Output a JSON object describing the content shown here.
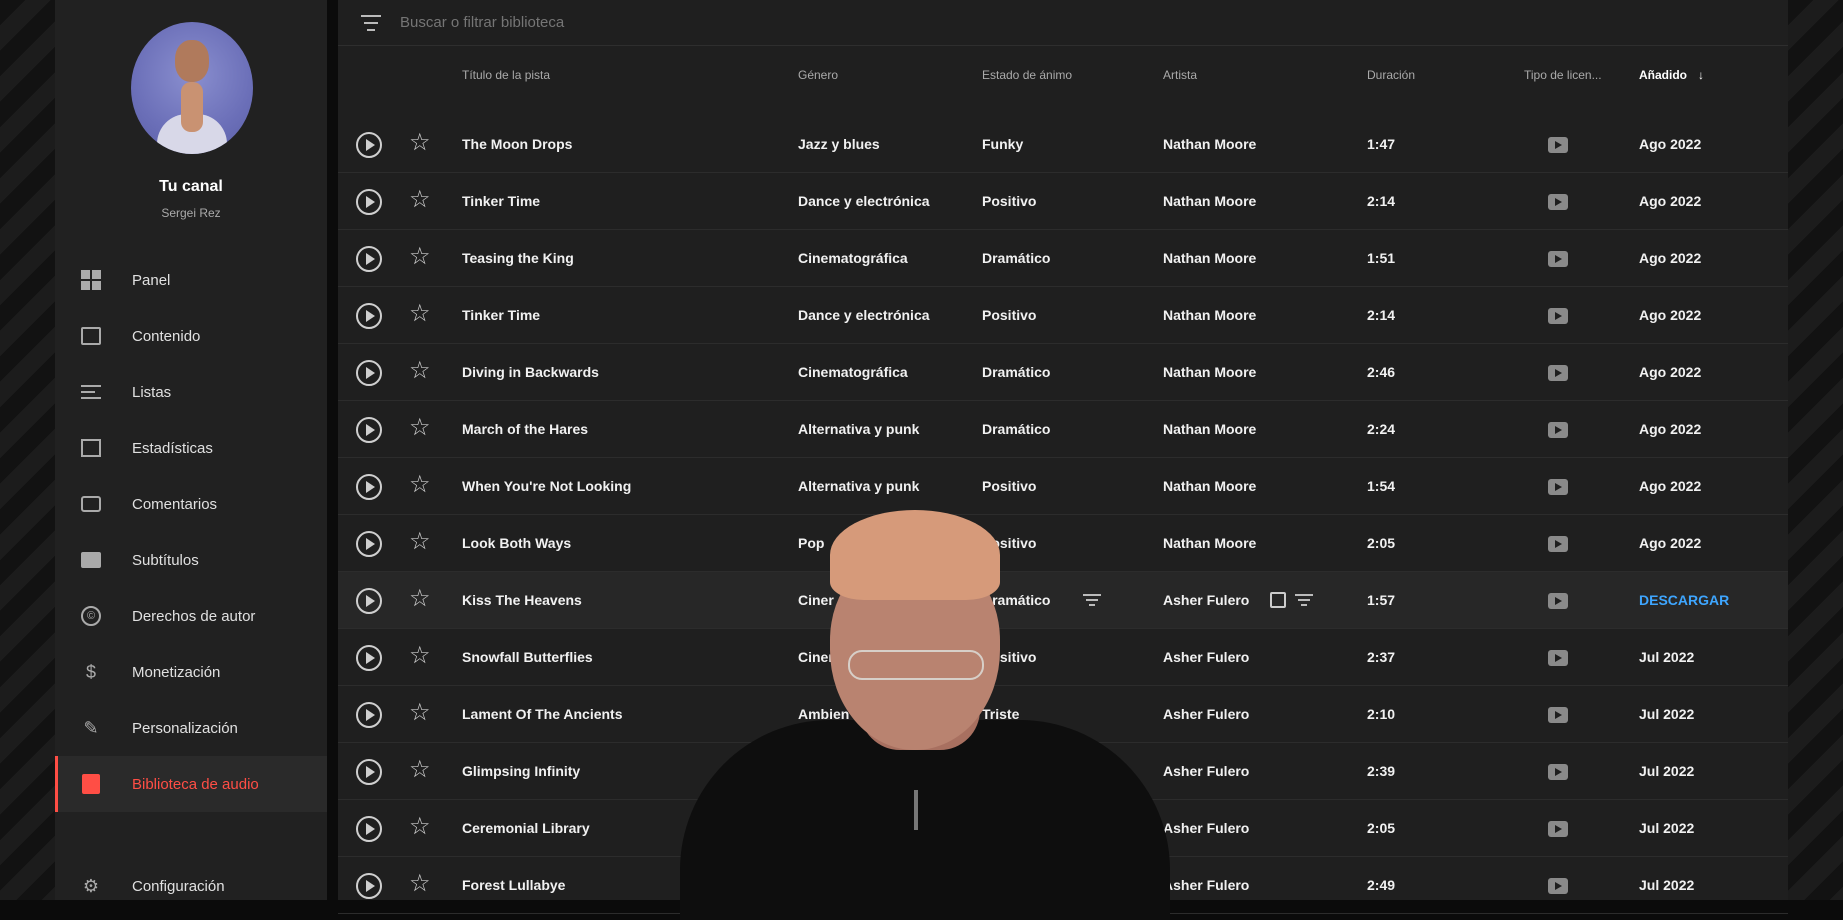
{
  "sidebar": {
    "channel_title": "Tu canal",
    "channel_sub": "Sergei Rez",
    "items": [
      {
        "label": "Panel",
        "icon": "dashboard-icon"
      },
      {
        "label": "Contenido",
        "icon": "content-icon"
      },
      {
        "label": "Listas",
        "icon": "playlist-icon"
      },
      {
        "label": "Estadísticas",
        "icon": "analytics-icon"
      },
      {
        "label": "Comentarios",
        "icon": "comments-icon"
      },
      {
        "label": "Subtítulos",
        "icon": "subtitles-icon"
      },
      {
        "label": "Derechos de autor",
        "icon": "copyright-icon"
      },
      {
        "label": "Monetización",
        "icon": "dollar-icon"
      },
      {
        "label": "Personalización",
        "icon": "magic-wand-icon"
      },
      {
        "label": "Biblioteca de audio",
        "icon": "audio-library-icon",
        "active": true
      },
      {
        "label": "Configuración",
        "icon": "gear-icon"
      }
    ]
  },
  "filter": {
    "placeholder": "Buscar o filtrar biblioteca"
  },
  "table": {
    "headers": {
      "title": "Título de la pista",
      "genre": "Género",
      "mood": "Estado de ánimo",
      "artist": "Artista",
      "duration": "Duración",
      "license": "Tipo de licen...",
      "added": "Añadido"
    },
    "sort_indicator": "↓",
    "rows": [
      {
        "title": "The Moon Drops",
        "genre": "Jazz y blues",
        "mood": "Funky",
        "artist": "Nathan Moore",
        "duration": "1:47",
        "added": "Ago 2022"
      },
      {
        "title": "Tinker Time",
        "genre": "Dance y electrónica",
        "mood": "Positivo",
        "artist": "Nathan Moore",
        "duration": "2:14",
        "added": "Ago 2022"
      },
      {
        "title": "Teasing the King",
        "genre": "Cinematográfica",
        "mood": "Dramático",
        "artist": "Nathan Moore",
        "duration": "1:51",
        "added": "Ago 2022"
      },
      {
        "title": "Tinker Time",
        "genre": "Dance y electrónica",
        "mood": "Positivo",
        "artist": "Nathan Moore",
        "duration": "2:14",
        "added": "Ago 2022"
      },
      {
        "title": "Diving in Backwards",
        "genre": "Cinematográfica",
        "mood": "Dramático",
        "artist": "Nathan Moore",
        "duration": "2:46",
        "added": "Ago 2022"
      },
      {
        "title": "March of the Hares",
        "genre": "Alternativa y punk",
        "mood": "Dramático",
        "artist": "Nathan Moore",
        "duration": "2:24",
        "added": "Ago 2022"
      },
      {
        "title": "When You're Not Looking",
        "genre": "Alternativa y punk",
        "mood": "Positivo",
        "artist": "Nathan Moore",
        "duration": "1:54",
        "added": "Ago 2022"
      },
      {
        "title": "Look Both Ways",
        "genre": "Pop",
        "mood": "Positivo",
        "artist": "Nathan Moore",
        "duration": "2:05",
        "added": "Ago 2022"
      },
      {
        "title": "Kiss The Heavens",
        "genre": "Ciner",
        "mood": "Dramático",
        "artist": "Asher Fulero",
        "duration": "1:57",
        "added": "DESCARGAR",
        "highlight": true
      },
      {
        "title": "Snowfall Butterflies",
        "genre": "Ciner",
        "mood": "Positivo",
        "artist": "Asher Fulero",
        "duration": "2:37",
        "added": "Jul 2022"
      },
      {
        "title": "Lament Of The Ancients",
        "genre": "Ambien",
        "mood": "Triste",
        "artist": "Asher Fulero",
        "duration": "2:10",
        "added": "Jul 2022"
      },
      {
        "title": "Glimpsing Infinity",
        "genre": "",
        "mood": "",
        "artist": "Asher Fulero",
        "duration": "2:39",
        "added": "Jul 2022"
      },
      {
        "title": "Ceremonial Library",
        "genre": "",
        "mood": "",
        "artist": "Asher Fulero",
        "duration": "2:05",
        "added": "Jul 2022"
      },
      {
        "title": "Forest Lullabye",
        "genre": "",
        "mood": "",
        "artist": "Asher Fulero",
        "duration": "2:49",
        "added": "Jul 2022"
      }
    ]
  },
  "colors": {
    "accent": "#ff4e45",
    "link": "#3ea6ff",
    "bg": "#1f1f1f"
  }
}
